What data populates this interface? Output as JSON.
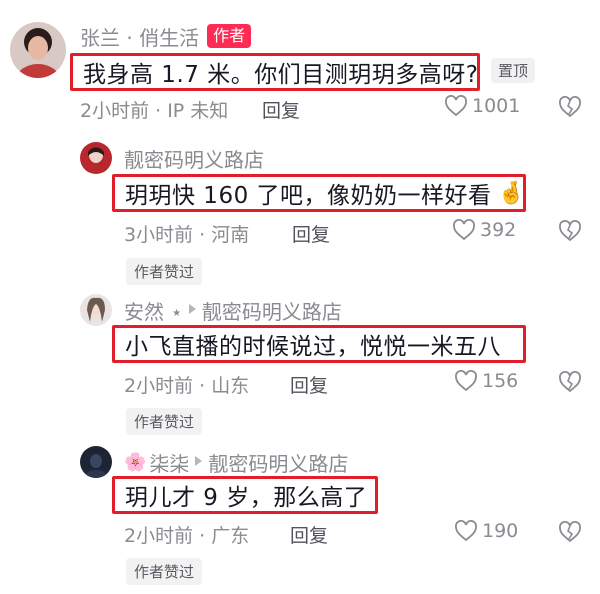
{
  "comments": [
    {
      "author": "张兰 · 俏生活",
      "author_badge": "作者",
      "text": "我身高 1.7 米。你们目测玥玥多高呀?",
      "pin_label": "置顶",
      "meta": "2小时前 · IP 未知",
      "reply_label": "回复",
      "likes": "1001"
    },
    {
      "author": "靓密码明义路店",
      "text": "玥玥快 160 了吧，像奶奶一样好看",
      "emoji": "🤞",
      "meta": "3小时前 · 河南",
      "reply_label": "回复",
      "likes": "392",
      "author_liked": "作者赞过"
    },
    {
      "author": "安然 ⋆",
      "reply_to": "靓密码明义路店",
      "text": "小飞直播的时候说过，悦悦一米五八",
      "meta": "2小时前 · 山东",
      "reply_label": "回复",
      "likes": "156",
      "author_liked": "作者赞过"
    },
    {
      "author_prefix": "🌸",
      "author": "柒柒",
      "reply_to": "靓密码明义路店",
      "text": "玥儿才 9 岁，那么高了",
      "meta": "2小时前 · 广东",
      "reply_label": "回复",
      "likes": "190",
      "author_liked": "作者赞过"
    }
  ],
  "icons": {
    "like": "heart-outline-icon",
    "dislike": "broken-heart-icon"
  },
  "colors": {
    "highlight_border": "#e01f2a",
    "author_badge": "#fe2c55",
    "secondary_text": "#8a8b91"
  }
}
